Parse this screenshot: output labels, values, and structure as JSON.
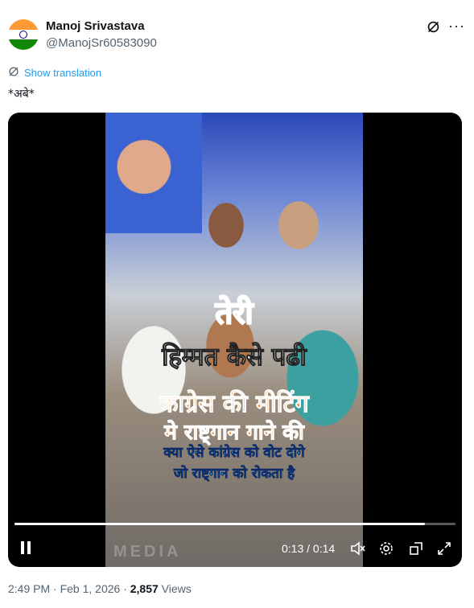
{
  "user": {
    "display_name": "Manoj Srivastava",
    "handle": "@ManojSr60583090",
    "avatar_colors": [
      "#ff9933",
      "#ffffff",
      "#138808"
    ]
  },
  "icons": {
    "grok": "grok-icon",
    "more": "more-options-icon",
    "translate": "globe-icon"
  },
  "tweet": {
    "translate_label": "Show translation",
    "text": "*अबे*"
  },
  "video": {
    "caption_lines": [
      "तेरी",
      "हिम्मत कैसे पढी",
      "काग्रेस की मीटिंग",
      "मे राष्ट्गान गाने की",
      "क्या ऐसे कांग्रेस को वोट दोगे",
      "जो राष्ट्गान को रोकता है"
    ],
    "watermark": "MEDIA",
    "time_display": "0:13 / 0:14",
    "progress_fraction": 0.93
  },
  "meta": {
    "timestamp": "2:49 PM · Feb 1, 2026 · ",
    "views_count": "2,857",
    "views_label": " Views"
  }
}
